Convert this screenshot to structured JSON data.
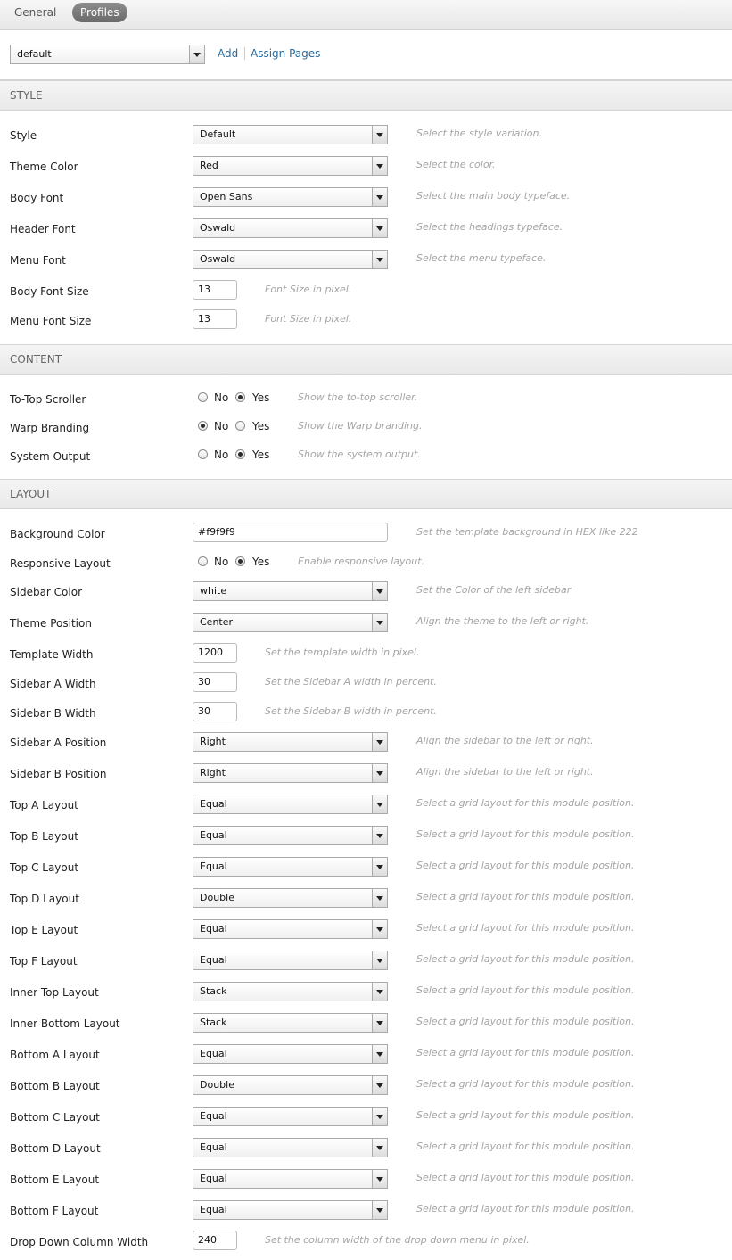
{
  "tabs": [
    {
      "label": "General"
    },
    {
      "label": "Profiles"
    }
  ],
  "profile": {
    "value": "default",
    "add": "Add",
    "assign": "Assign Pages"
  },
  "sections": {
    "style": "STYLE",
    "content": "CONTENT",
    "layout": "LAYOUT"
  },
  "radio_labels": {
    "no": "No",
    "yes": "Yes"
  },
  "style": {
    "style": {
      "label": "Style",
      "value": "Default",
      "hint": "Select the style variation."
    },
    "theme_color": {
      "label": "Theme Color",
      "value": "Red",
      "hint": "Select the color."
    },
    "body_font": {
      "label": "Body Font",
      "value": "Open Sans",
      "hint": "Select the main body typeface."
    },
    "header_font": {
      "label": "Header Font",
      "value": "Oswald",
      "hint": "Select the headings typeface."
    },
    "menu_font": {
      "label": "Menu Font",
      "value": "Oswald",
      "hint": "Select the menu typeface."
    },
    "body_font_size": {
      "label": "Body Font Size",
      "value": "13",
      "hint": "Font Size in pixel."
    },
    "menu_font_size": {
      "label": "Menu Font Size",
      "value": "13",
      "hint": "Font Size in pixel."
    }
  },
  "content": {
    "to_top": {
      "label": "To-Top Scroller",
      "selected": "yes",
      "hint": "Show the to-top scroller."
    },
    "warp_branding": {
      "label": "Warp Branding",
      "selected": "no",
      "hint": "Show the Warp branding."
    },
    "system_output": {
      "label": "System Output",
      "selected": "yes",
      "hint": "Show the system output."
    }
  },
  "layout": {
    "background_color": {
      "label": "Background Color",
      "value": "#f9f9f9",
      "hint": "Set the template background in HEX like 222"
    },
    "responsive": {
      "label": "Responsive Layout",
      "selected": "yes",
      "hint": "Enable responsive layout."
    },
    "sidebar_color": {
      "label": "Sidebar Color",
      "value": "white",
      "hint": "Set the Color of the left sidebar"
    },
    "theme_position": {
      "label": "Theme Position",
      "value": "Center",
      "hint": "Align the theme to the left or right."
    },
    "template_width": {
      "label": "Template Width",
      "value": "1200",
      "hint": "Set the template width in pixel."
    },
    "sidebar_a_width": {
      "label": "Sidebar A Width",
      "value": "30",
      "hint": "Set the Sidebar A width in percent."
    },
    "sidebar_b_width": {
      "label": "Sidebar B Width",
      "value": "30",
      "hint": "Set the Sidebar B width in percent."
    },
    "sidebar_a_position": {
      "label": "Sidebar A Position",
      "value": "Right",
      "hint": "Align the sidebar to the left or right."
    },
    "sidebar_b_position": {
      "label": "Sidebar B Position",
      "value": "Right",
      "hint": "Align the sidebar to the left or right."
    },
    "grid": [
      {
        "label": "Top A Layout",
        "value": "Equal",
        "hint": "Select a grid layout for this module position."
      },
      {
        "label": "Top B Layout",
        "value": "Equal",
        "hint": "Select a grid layout for this module position."
      },
      {
        "label": "Top C Layout",
        "value": "Equal",
        "hint": "Select a grid layout for this module position."
      },
      {
        "label": "Top D Layout",
        "value": "Double",
        "hint": "Select a grid layout for this module position."
      },
      {
        "label": "Top E Layout",
        "value": "Equal",
        "hint": "Select a grid layout for this module position."
      },
      {
        "label": "Top F Layout",
        "value": "Equal",
        "hint": "Select a grid layout for this module position."
      },
      {
        "label": "Inner Top Layout",
        "value": "Stack",
        "hint": "Select a grid layout for this module position."
      },
      {
        "label": "Inner Bottom Layout",
        "value": "Stack",
        "hint": "Select a grid layout for this module position."
      },
      {
        "label": "Bottom A Layout",
        "value": "Equal",
        "hint": "Select a grid layout for this module position."
      },
      {
        "label": "Bottom B Layout",
        "value": "Double",
        "hint": "Select a grid layout for this module position."
      },
      {
        "label": "Bottom C Layout",
        "value": "Equal",
        "hint": "Select a grid layout for this module position."
      },
      {
        "label": "Bottom D Layout",
        "value": "Equal",
        "hint": "Select a grid layout for this module position."
      },
      {
        "label": "Bottom E Layout",
        "value": "Equal",
        "hint": "Select a grid layout for this module position."
      },
      {
        "label": "Bottom F Layout",
        "value": "Equal",
        "hint": "Select a grid layout for this module position."
      }
    ],
    "dropdown_width": {
      "label": "Drop Down Column Width",
      "value": "240",
      "hint": "Set the column width of the drop down menu in pixel."
    }
  }
}
